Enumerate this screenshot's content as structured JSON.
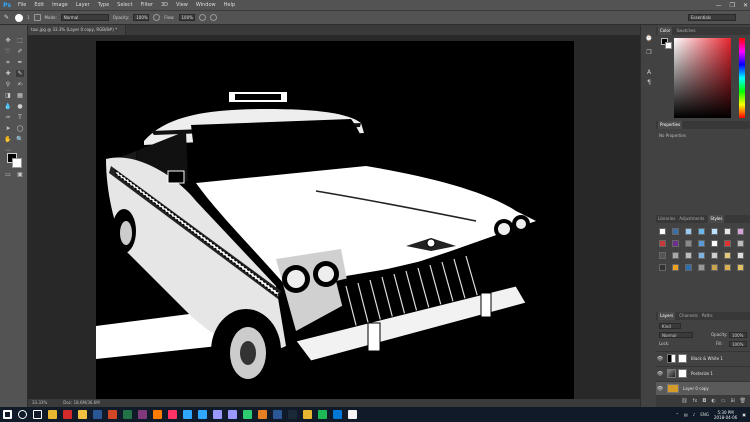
{
  "app": {
    "logo": "Ps",
    "menu": [
      "File",
      "Edit",
      "Image",
      "Layer",
      "Type",
      "Select",
      "Filter",
      "3D",
      "View",
      "Window",
      "Help"
    ]
  },
  "window_controls": {
    "minimize": "—",
    "maximize": "❐",
    "close": "✕"
  },
  "options_bar": {
    "mode_label": "Mode:",
    "mode_value": "Normal",
    "opacity_label": "Opacity:",
    "opacity_value": "100%",
    "flow_label": "Flow:",
    "flow_value": "100%",
    "brush_size": "1",
    "workspace": "Essentials"
  },
  "document": {
    "tab_title": "taxi.jpg @ 33.3% (Layer 0 copy, RGB/8#) *",
    "zoom": "33.33%",
    "doc_size": "Doc: 18.6M/36.6M"
  },
  "panels": {
    "color_tabs": [
      "Color",
      "Swatches"
    ],
    "properties_tabs": [
      "Properties"
    ],
    "properties_text": "No Properties",
    "styles_tabs": [
      "Libraries",
      "Adjustments",
      "Styles"
    ],
    "layers_tabs": [
      "Layers",
      "Channels",
      "Paths"
    ],
    "layers_kind": "Kind",
    "blend_mode": "Normal",
    "opacity_label": "Opacity:",
    "opacity_value": "100%",
    "lock_label": "Lock:",
    "fill_label": "Fill:",
    "fill_value": "100%",
    "layers": [
      {
        "name": "Black & White 1",
        "selected": false
      },
      {
        "name": "Posterize 1",
        "selected": false
      },
      {
        "name": "Layer 0 copy",
        "selected": true
      }
    ]
  },
  "taskbar": {
    "time": "5:30 PM",
    "date": "2018-04-06",
    "lang": "ENG",
    "icons": [
      "start-icon",
      "search-icon",
      "task-view-icon",
      "chrome-icon",
      "opera-icon",
      "file-explorer-icon",
      "word-icon",
      "powerpoint-icon",
      "excel-icon",
      "onenote-icon",
      "illustrator-icon",
      "indesign-icon",
      "lightroom-icon",
      "photoshop-icon",
      "premiere-icon",
      "after-effects-icon",
      "maps-icon",
      "paint-icon",
      "word-alt-icon",
      "steam-icon",
      "chrome-alt-icon",
      "spotify-icon",
      "media-icon",
      "notes-icon"
    ],
    "icon_colors": [
      "#ffffff",
      "#ffffff",
      "#ffffff",
      "#e8b730",
      "#d42a2a",
      "#f0c040",
      "#2b5797",
      "#d24726",
      "#217346",
      "#80397b",
      "#ff7c00",
      "#ff3366",
      "#31a8ff",
      "#31a8ff",
      "#9999ff",
      "#9999ff",
      "#2ecc71",
      "#e67e22",
      "#2b5797",
      "#1b2838",
      "#e8b730",
      "#1db954",
      "#0078d7",
      "#f5f5f5"
    ]
  },
  "colors": {
    "accent": "#31a8ff",
    "panel": "#424242",
    "chrome": "#535353"
  }
}
